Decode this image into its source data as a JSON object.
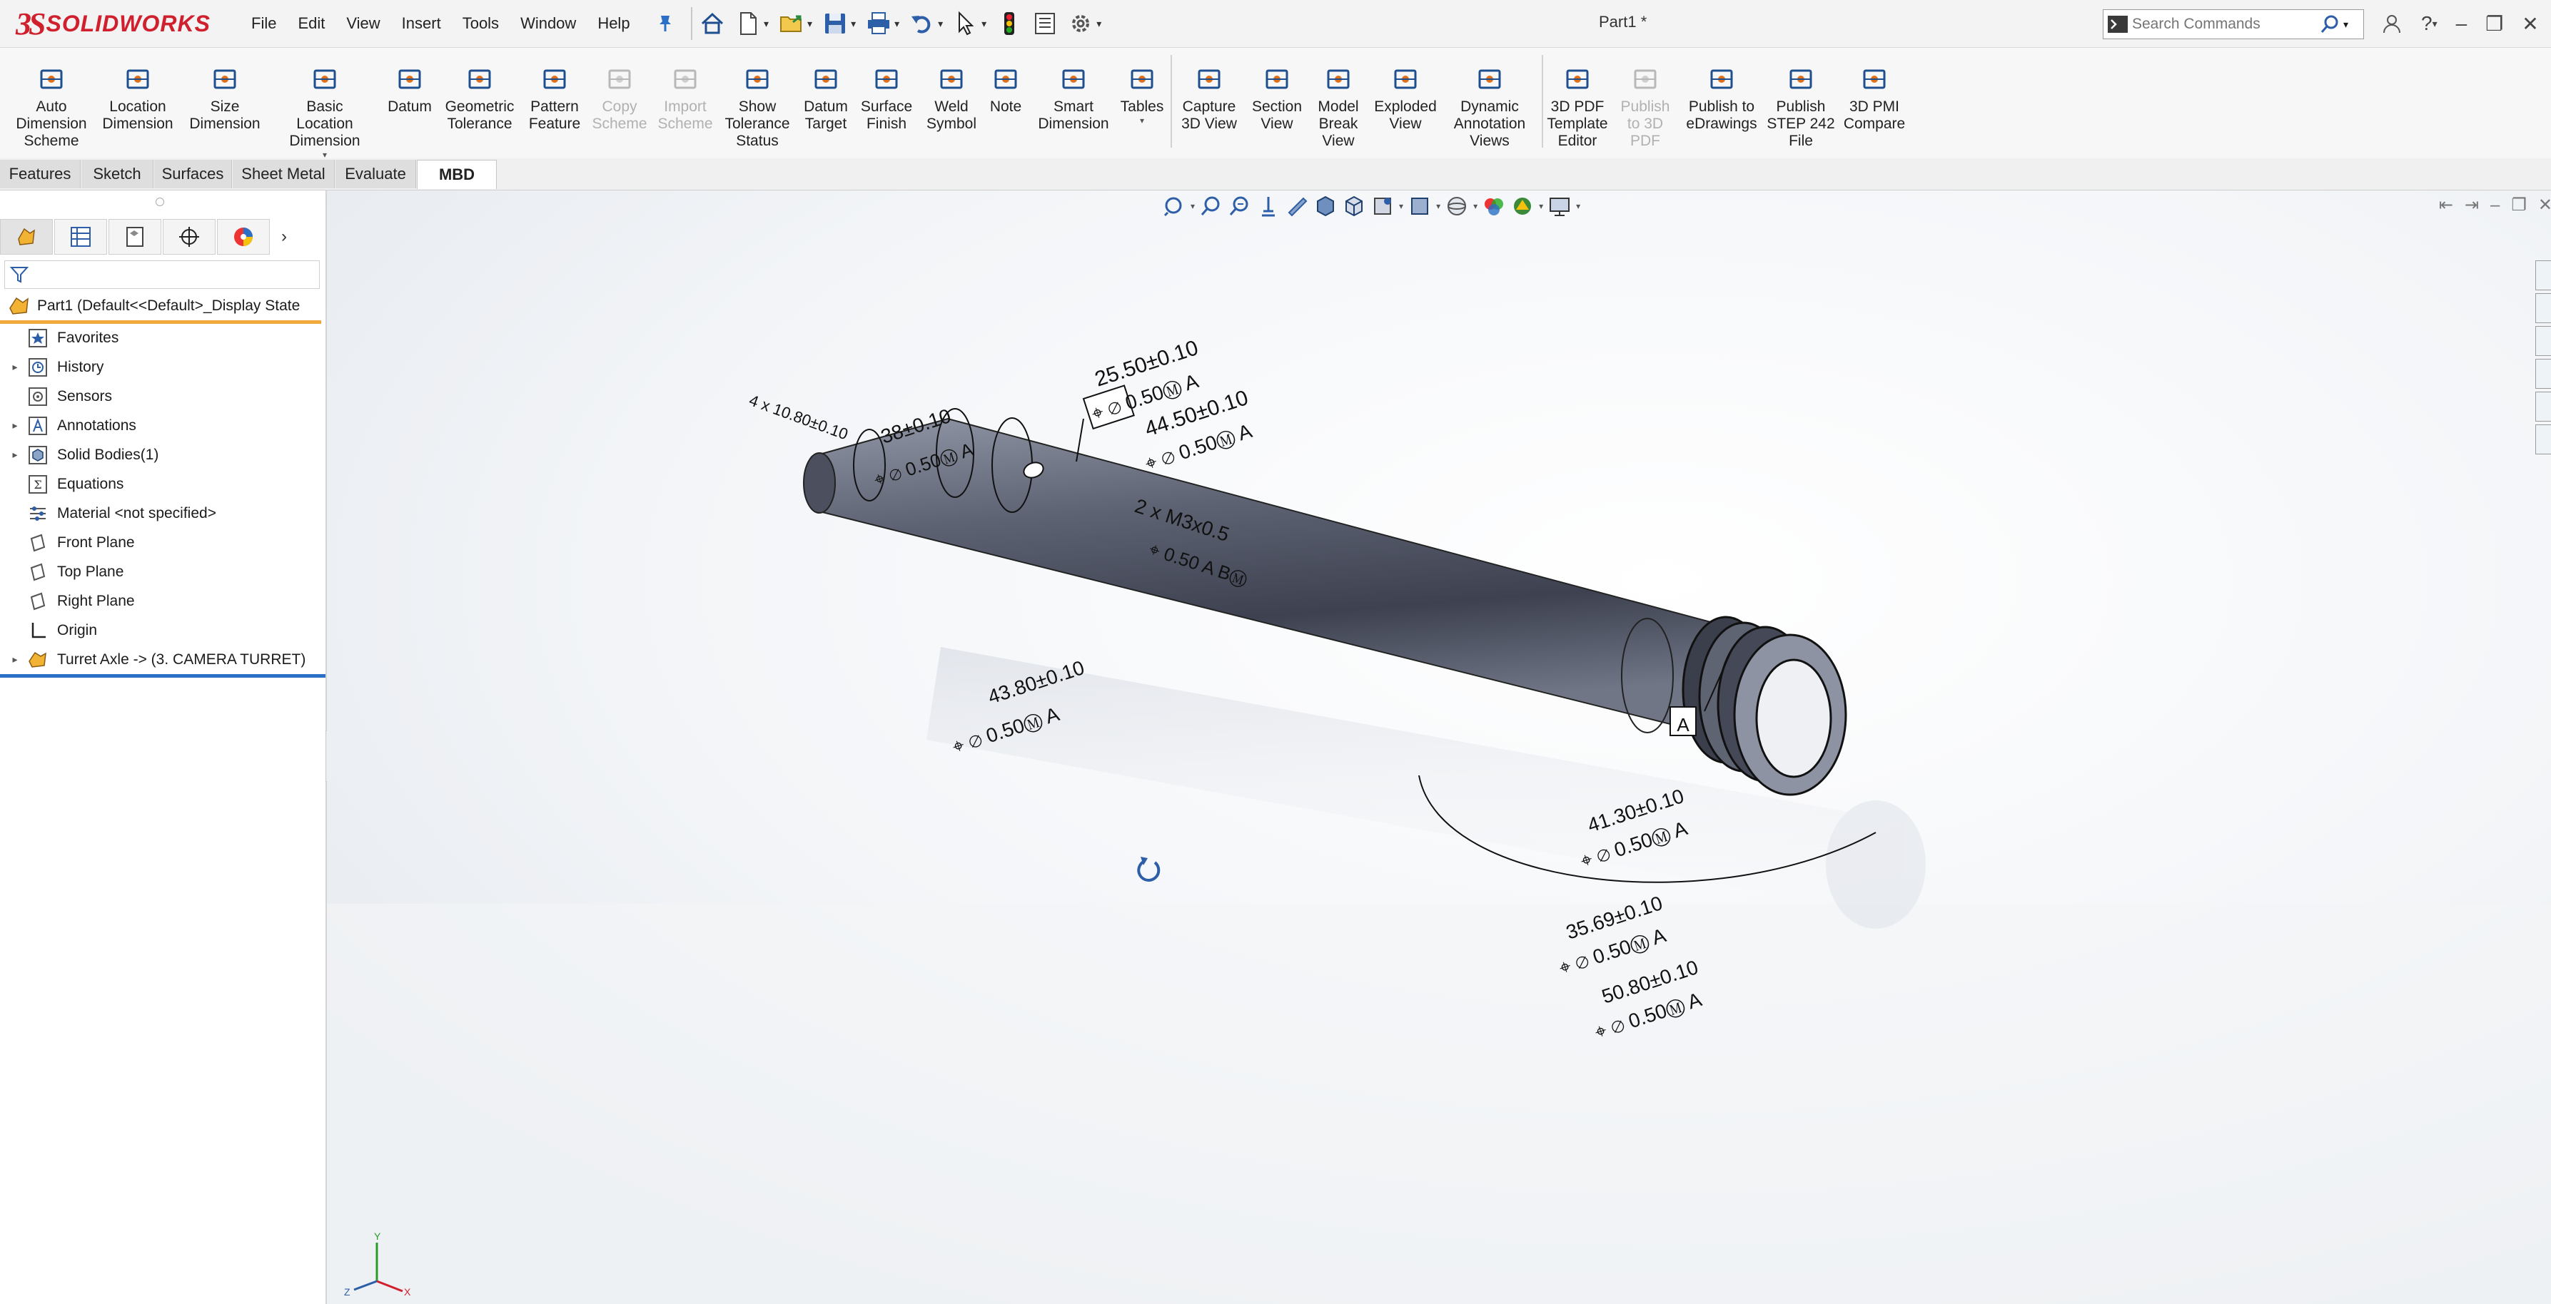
{
  "app": {
    "logo_ds": "3S",
    "logo_text": "SOLIDWORKS",
    "document_title": "Part1 *"
  },
  "menu": [
    "File",
    "Edit",
    "View",
    "Insert",
    "Tools",
    "Window",
    "Help"
  ],
  "search": {
    "placeholder": "Search Commands"
  },
  "ribbon": [
    {
      "label": "Auto\nDimension\nScheme",
      "icon": "auto-dimension-icon",
      "enabled": true
    },
    {
      "label": "Location\nDimension",
      "icon": "location-dimension-icon",
      "enabled": true
    },
    {
      "label": "Size\nDimension",
      "icon": "size-dimension-icon",
      "enabled": true
    },
    {
      "label": "Basic Location\nDimension",
      "icon": "basic-location-dimension-icon",
      "enabled": true
    },
    {
      "label": "Datum",
      "icon": "datum-icon",
      "enabled": true
    },
    {
      "label": "Geometric\nTolerance",
      "icon": "geometric-tolerance-icon",
      "enabled": true
    },
    {
      "label": "Pattern\nFeature",
      "icon": "pattern-feature-icon",
      "enabled": true
    },
    {
      "label": "Copy\nScheme",
      "icon": "copy-scheme-icon",
      "enabled": false
    },
    {
      "label": "Import\nScheme",
      "icon": "import-scheme-icon",
      "enabled": false
    },
    {
      "label": "Show\nTolerance\nStatus",
      "icon": "tolerance-status-icon",
      "enabled": true
    },
    {
      "label": "Datum\nTarget",
      "icon": "datum-target-icon",
      "enabled": true
    },
    {
      "label": "Surface\nFinish",
      "icon": "surface-finish-icon",
      "enabled": true
    },
    {
      "label": "Weld\nSymbol",
      "icon": "weld-symbol-icon",
      "enabled": true
    },
    {
      "label": "Note",
      "icon": "note-icon",
      "enabled": true
    },
    {
      "label": "Smart\nDimension",
      "icon": "smart-dimension-icon",
      "enabled": true
    },
    {
      "label": "Tables",
      "icon": "tables-icon",
      "enabled": true
    },
    {
      "label": "Capture\n3D View",
      "icon": "capture-3d-view-icon",
      "enabled": true
    },
    {
      "label": "Section\nView",
      "icon": "section-view-icon",
      "enabled": true
    },
    {
      "label": "Model\nBreak\nView",
      "icon": "model-break-view-icon",
      "enabled": true
    },
    {
      "label": "Exploded\nView",
      "icon": "exploded-view-icon",
      "enabled": true
    },
    {
      "label": "Dynamic\nAnnotation\nViews",
      "icon": "dynamic-annotation-views-icon",
      "enabled": true
    },
    {
      "label": "3D PDF\nTemplate\nEditor",
      "icon": "3d-pdf-template-icon",
      "enabled": true
    },
    {
      "label": "Publish\nto 3D\nPDF",
      "icon": "publish-3d-pdf-icon",
      "enabled": false
    },
    {
      "label": "Publish to\neDrawings",
      "icon": "edrawings-icon",
      "enabled": true
    },
    {
      "label": "Publish\nSTEP 242\nFile",
      "icon": "step-242-icon",
      "enabled": true
    },
    {
      "label": "3D PMI\nCompare",
      "icon": "pmi-compare-icon",
      "enabled": true
    }
  ],
  "tabs": [
    {
      "label": "Features",
      "active": false
    },
    {
      "label": "Sketch",
      "active": false
    },
    {
      "label": "Surfaces",
      "active": false
    },
    {
      "label": "Sheet Metal",
      "active": false
    },
    {
      "label": "Evaluate",
      "active": false
    },
    {
      "label": "MBD",
      "active": true
    }
  ],
  "tree": {
    "root": "Part1  (Default<<Default>_Display State",
    "nodes": [
      {
        "label": "Favorites",
        "expandable": false,
        "icon": "favorites-icon"
      },
      {
        "label": "History",
        "expandable": true,
        "icon": "history-icon"
      },
      {
        "label": "Sensors",
        "expandable": false,
        "icon": "sensors-icon"
      },
      {
        "label": "Annotations",
        "expandable": true,
        "icon": "annotations-icon"
      },
      {
        "label": "Solid Bodies(1)",
        "expandable": true,
        "icon": "solid-bodies-icon"
      },
      {
        "label": "Equations",
        "expandable": false,
        "icon": "equations-icon"
      },
      {
        "label": "Material <not specified>",
        "expandable": false,
        "icon": "material-icon"
      },
      {
        "label": "Front Plane",
        "expandable": false,
        "icon": "plane-icon"
      },
      {
        "label": "Top Plane",
        "expandable": false,
        "icon": "plane-icon"
      },
      {
        "label": "Right Plane",
        "expandable": false,
        "icon": "plane-icon"
      },
      {
        "label": "Origin",
        "expandable": false,
        "icon": "origin-icon"
      },
      {
        "label": "Turret Axle -> (3. CAMERA TURRET)",
        "expandable": true,
        "icon": "part-reference-icon"
      }
    ]
  },
  "annotations": {
    "d1": "25.50±0.10",
    "d2": "44.50±0.10",
    "d3": "38±0.10",
    "d4": "41.30±0.10",
    "d5": "35.69±0.10",
    "d6": "50.80±0.10",
    "d7": "43.80±0.10",
    "tol": "0.50",
    "datum_a": "A",
    "datum_b": "B",
    "thread": "2 x M3x0.5",
    "holes": "4 x 10.80±0.10"
  },
  "colors": {
    "accent_orange": "#f0a93a",
    "accent_blue": "#2b6fc6",
    "logo_red": "#d0202e"
  }
}
